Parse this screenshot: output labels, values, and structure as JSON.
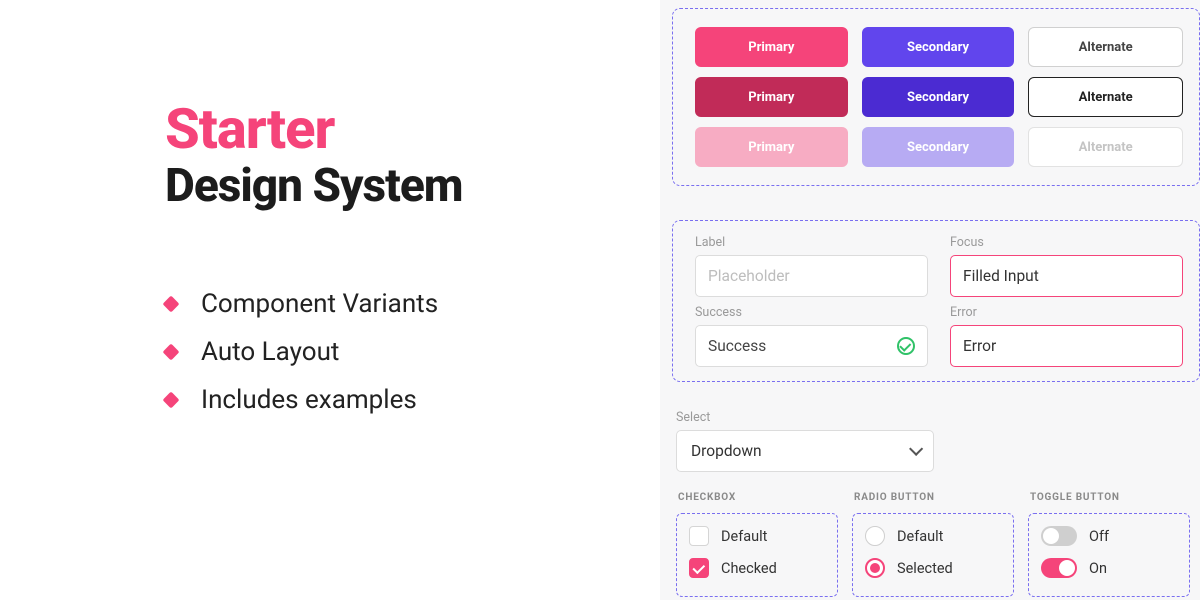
{
  "hero": {
    "title1": "Starter",
    "title2": "Design System"
  },
  "features": [
    "Component Variants",
    "Auto Layout",
    "Includes examples"
  ],
  "buttons": {
    "primary": "Primary",
    "secondary": "Secondary",
    "alternate": "Alternate"
  },
  "inputs": {
    "label": {
      "label": "Label",
      "placeholder": "Placeholder"
    },
    "focus": {
      "label": "Focus",
      "value": "Filled Input"
    },
    "success": {
      "label": "Success",
      "value": "Success"
    },
    "error": {
      "label": "Error",
      "value": "Error"
    }
  },
  "select": {
    "label": "Select",
    "value": "Dropdown"
  },
  "controls": {
    "checkbox": {
      "title": "Checkbox",
      "default": "Default",
      "checked": "Checked"
    },
    "radio": {
      "title": "Radio Button",
      "default": "Default",
      "selected": "Selected"
    },
    "toggle": {
      "title": "Toggle Button",
      "off": "Off",
      "on": "On"
    }
  },
  "colors": {
    "accent": "#f5447a",
    "secondary": "#6145ed",
    "success": "#30c268"
  }
}
